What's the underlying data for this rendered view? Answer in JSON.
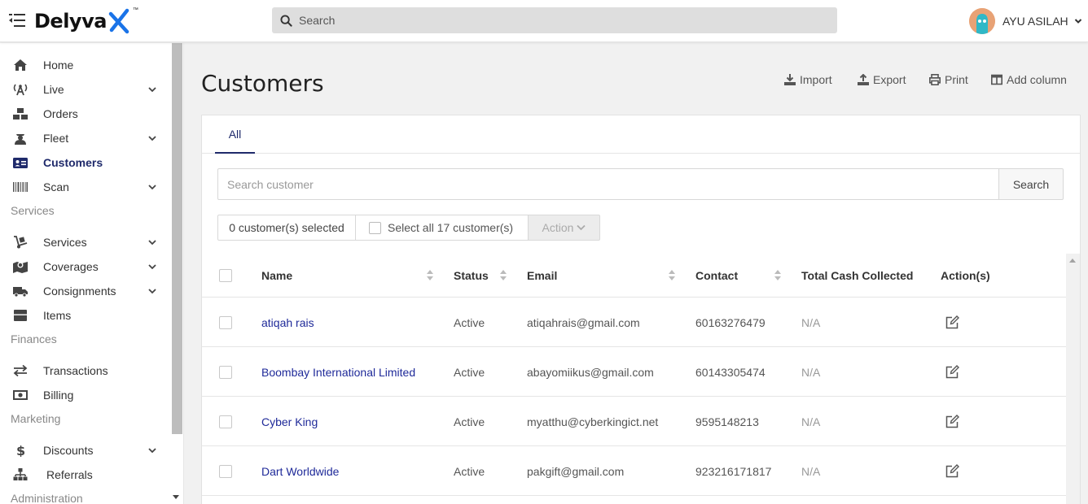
{
  "brand": {
    "name": "Delyva",
    "tm": "™",
    "accent": "#1f2a6b",
    "x_color": "#1a73e8"
  },
  "top_search": {
    "placeholder": "Search"
  },
  "user": {
    "name": "AYU ASILAH"
  },
  "sidebar": {
    "items": [
      {
        "label": "Home",
        "icon": "home-icon",
        "has_dropdown": false
      },
      {
        "label": "Live",
        "icon": "broadcast-icon",
        "has_dropdown": true
      },
      {
        "label": "Orders",
        "icon": "boxes-icon",
        "has_dropdown": false
      },
      {
        "label": "Fleet",
        "icon": "driver-icon",
        "has_dropdown": true
      },
      {
        "label": "Customers",
        "icon": "id-card-icon",
        "has_dropdown": false,
        "active": true
      },
      {
        "label": "Scan",
        "icon": "barcode-icon",
        "has_dropdown": true
      }
    ],
    "section_services": "Services",
    "services_items": [
      {
        "label": "Services",
        "icon": "dolly-icon",
        "has_dropdown": true
      },
      {
        "label": "Coverages",
        "icon": "map-marker-icon",
        "has_dropdown": true
      },
      {
        "label": "Consignments",
        "icon": "truck-icon",
        "has_dropdown": true
      },
      {
        "label": "Items",
        "icon": "box-icon",
        "has_dropdown": false
      }
    ],
    "section_finances": "Finances",
    "finances_items": [
      {
        "label": "Transactions",
        "icon": "exchange-icon",
        "has_dropdown": false
      },
      {
        "label": "Billing",
        "icon": "money-bill-icon",
        "has_dropdown": false
      }
    ],
    "section_marketing": "Marketing",
    "marketing_items": [
      {
        "label": "Discounts",
        "icon": "dollar-icon",
        "has_dropdown": true
      },
      {
        "label": "Referrals",
        "icon": "sitemap-icon",
        "has_dropdown": false
      }
    ],
    "section_administration": "Administration"
  },
  "page": {
    "title": "Customers",
    "toolbar": {
      "import": "Import",
      "export": "Export",
      "print": "Print",
      "add_column": "Add column"
    }
  },
  "tabs": {
    "all": "All"
  },
  "customer_search": {
    "placeholder": "Search customer",
    "button": "Search"
  },
  "selection": {
    "count_text": "0 customer(s) selected",
    "select_all": "Select all 17 customer(s)",
    "action": "Action"
  },
  "table": {
    "headers": {
      "name": "Name",
      "status": "Status",
      "email": "Email",
      "contact": "Contact",
      "cash": "Total Cash Collected",
      "actions": "Action(s)"
    },
    "rows": [
      {
        "name": "atiqah rais",
        "status": "Active",
        "email": "atiqahrais@gmail.com",
        "contact": "60163276479",
        "cash": "N/A"
      },
      {
        "name": "Boombay International Limited",
        "status": "Active",
        "email": "abayomiikus@gmail.com",
        "contact": "60143305474",
        "cash": "N/A"
      },
      {
        "name": "Cyber King",
        "status": "Active",
        "email": "myatthu@cyberkingict.net",
        "contact": "9595148213",
        "cash": "N/A"
      },
      {
        "name": "Dart Worldwide",
        "status": "Active",
        "email": "pakgift@gmail.com",
        "contact": "923216171817",
        "cash": "N/A"
      }
    ]
  }
}
